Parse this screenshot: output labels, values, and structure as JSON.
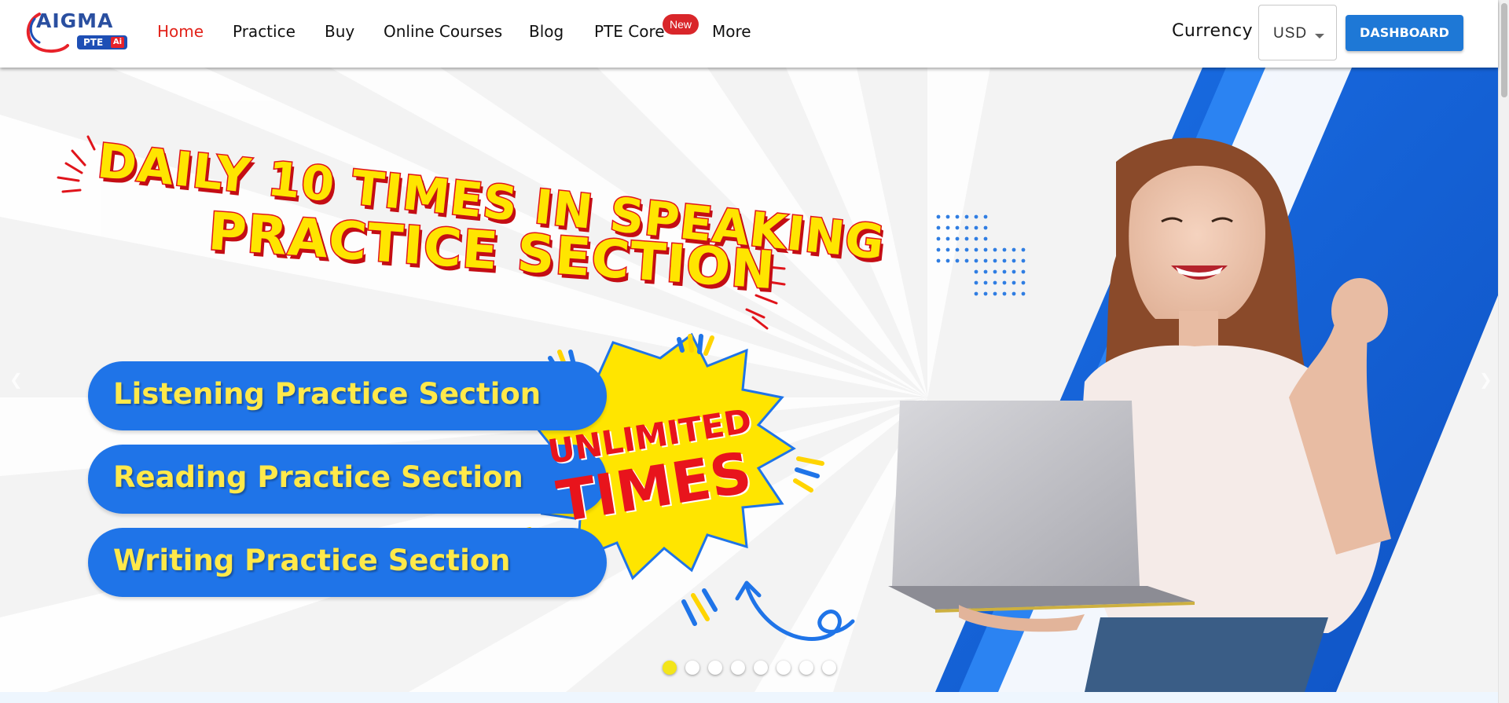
{
  "brand": {
    "logo_text": "AIGMA",
    "logo_sub": "PTE",
    "logo_ai": "Ai"
  },
  "nav": {
    "items": [
      {
        "label": "Home",
        "active": true
      },
      {
        "label": "Practice",
        "active": false
      },
      {
        "label": "Buy",
        "active": false
      },
      {
        "label": "Online Courses",
        "active": false
      },
      {
        "label": "Blog",
        "active": false
      },
      {
        "label": "PTE Core",
        "active": false
      },
      {
        "label": "More",
        "active": false
      }
    ],
    "new_badge": "New"
  },
  "currency": {
    "label": "Currency",
    "selected": "USD"
  },
  "dashboard_label": "DASHBOARD",
  "hero": {
    "headline_line1": "DAILY 10 TIMES IN SPEAKING",
    "headline_line2": "PRACTICE SECTION",
    "sections": [
      "Listening Practice Section",
      "Reading Practice Section",
      "Writing Practice Section"
    ],
    "burst_line1": "UNLIMITED",
    "burst_line2": "TIMES",
    "slides_total": 8,
    "active_slide": 1
  },
  "colors": {
    "accent_red": "#e2231a",
    "primary_blue": "#1e78d6",
    "hero_yellow": "#ffe500",
    "pill_blue": "#1f74e8"
  }
}
